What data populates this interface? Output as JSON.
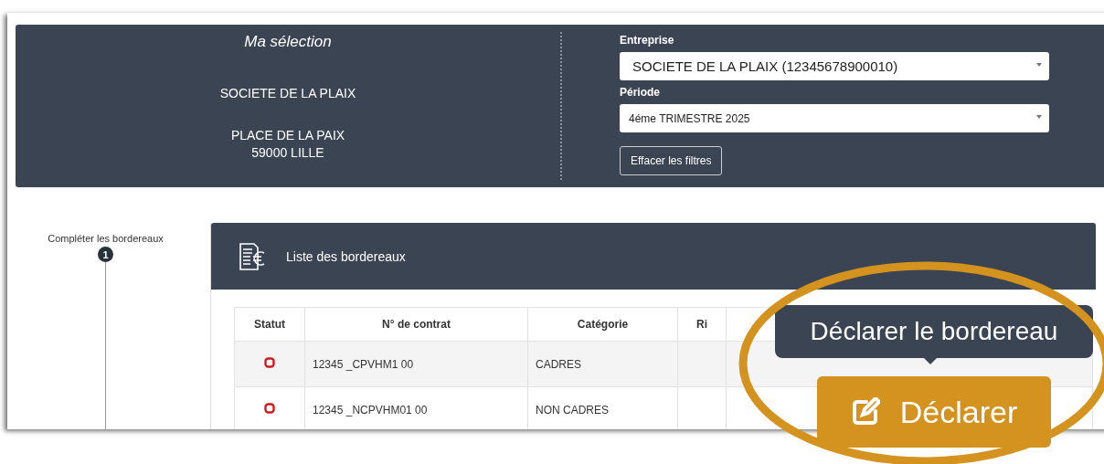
{
  "selection": {
    "title": "Ma sélection",
    "company": "SOCIETE DE LA PLAIX",
    "address": [
      "PLACE DE LA PAIX",
      "59000 LILLE"
    ]
  },
  "filters": [
    {
      "label": "Entreprise",
      "value": "SOCIETE DE LA PLAIX (12345678900010)",
      "kind": "large"
    },
    {
      "label": "Période",
      "value": "4éme TRIMESTRE 2025",
      "kind": "small"
    }
  ],
  "clear_button": "Effacer les filtres",
  "steps": [
    {
      "label": "Compléter les bordereaux",
      "number": "1"
    }
  ],
  "panel": {
    "title": "Liste des bordereaux"
  },
  "table": {
    "columns": [
      "Statut",
      "N° de contrat",
      "Catégorie",
      "Ri"
    ],
    "rows": [
      {
        "contract": "12345 _CPVHM1 00",
        "category": "CADRES"
      },
      {
        "contract": "12345 _NCPVHM01 00",
        "category": "NON CADRES"
      }
    ]
  },
  "callout": {
    "tooltip": "Déclarer le bordereau",
    "button": "Déclarer"
  }
}
